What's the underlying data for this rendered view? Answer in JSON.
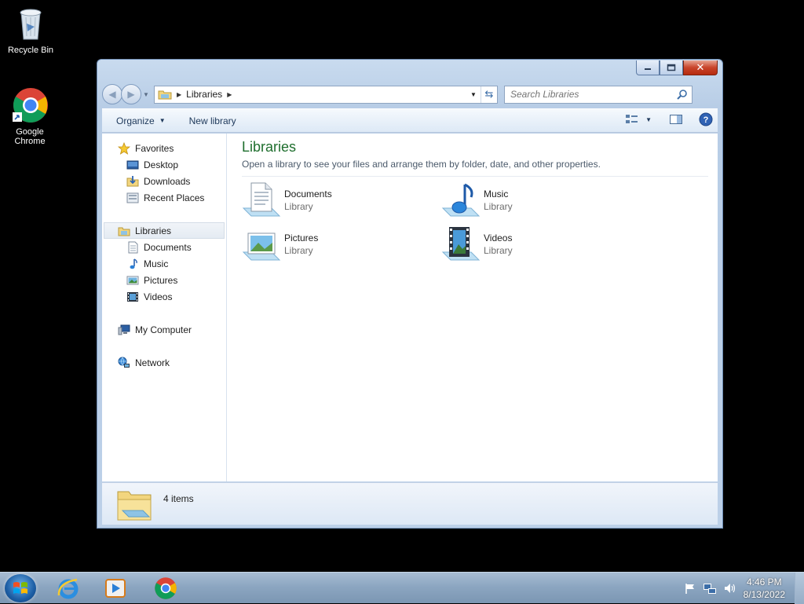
{
  "desktop": {
    "icons": [
      {
        "label": "Recycle Bin",
        "icon": "recycle-bin-icon"
      },
      {
        "label": "Google Chrome",
        "icon": "chrome-icon"
      }
    ]
  },
  "window": {
    "caption_buttons": {
      "minimize": "minimize-icon",
      "maximize": "maximize-icon",
      "close": "✕"
    },
    "address": {
      "crumbs": [
        "Libraries"
      ]
    },
    "search": {
      "placeholder": "Search Libraries"
    },
    "toolbar": {
      "organize": "Organize",
      "new_library": "New library"
    },
    "nav": {
      "favorites": {
        "label": "Favorites",
        "items": [
          "Desktop",
          "Downloads",
          "Recent Places"
        ]
      },
      "libraries": {
        "label": "Libraries",
        "items": [
          "Documents",
          "Music",
          "Pictures",
          "Videos"
        ]
      },
      "computer": "My Computer",
      "network": "Network"
    },
    "main": {
      "title": "Libraries",
      "subtitle": "Open a library to see your files and arrange them by folder, date, and other properties.",
      "libraries": [
        {
          "name": "Documents",
          "type": "Library",
          "icon": "documents-library-icon"
        },
        {
          "name": "Music",
          "type": "Library",
          "icon": "music-library-icon"
        },
        {
          "name": "Pictures",
          "type": "Library",
          "icon": "pictures-library-icon"
        },
        {
          "name": "Videos",
          "type": "Library",
          "icon": "videos-library-icon"
        }
      ]
    },
    "details": {
      "count": "4 items"
    }
  },
  "taskbar": {
    "apps": [
      "internet-explorer-icon",
      "media-player-icon",
      "chrome-icon"
    ],
    "clock": {
      "time": "4:46 PM",
      "date": "8/13/2022"
    }
  },
  "colors": {
    "title_green": "#1e6e2d",
    "close_red": "#c8442b",
    "taskbar": "#8ca6c1"
  }
}
